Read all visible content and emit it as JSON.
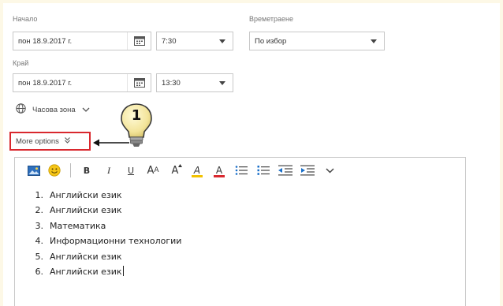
{
  "start": {
    "label": "Начало",
    "date": "пон 18.9.2017 г.",
    "time": "7:30"
  },
  "end": {
    "label": "Край",
    "date": "пон 18.9.2017 г.",
    "time": "13:30"
  },
  "duration": {
    "label": "Времетраене",
    "value": "По избор"
  },
  "timezone": {
    "label": "Часова зона"
  },
  "more_options": {
    "label": "More options"
  },
  "callout": {
    "number": "1"
  },
  "toolbar": {
    "buttons": [
      "image",
      "emoji",
      "bold",
      "italic",
      "underline",
      "font-size",
      "grow-font",
      "highlight",
      "font-color",
      "bullets",
      "numbering",
      "decrease-indent",
      "increase-indent",
      "more"
    ],
    "bold": "B",
    "italic": "I",
    "underline": "U",
    "font_size": "A",
    "grow_font": "A",
    "highlight": "A",
    "font_color": "A"
  },
  "colors": {
    "highlight_accent": "#f2c200",
    "font_color_accent": "#d9282e",
    "callout_border": "#d9282e",
    "indent_accent": "#1a6fc9"
  },
  "editor": {
    "items": [
      {
        "num": "1.",
        "text": "Английски език"
      },
      {
        "num": "2.",
        "text": "Английски език"
      },
      {
        "num": "3.",
        "text": "Математика"
      },
      {
        "num": "4.",
        "text": "Информационни технологии"
      },
      {
        "num": "5.",
        "text": "Английски език"
      },
      {
        "num": "6.",
        "text": "Английски език"
      }
    ]
  }
}
